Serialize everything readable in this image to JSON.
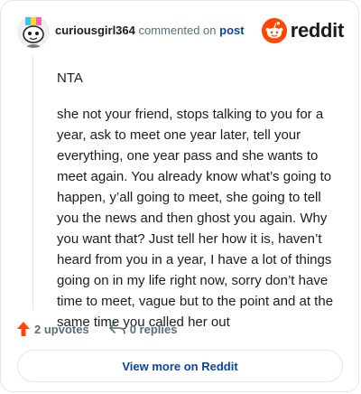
{
  "header": {
    "username": "curiousgirl364",
    "commented_text": "commented on",
    "post_link": "post",
    "brand": "reddit"
  },
  "comment": {
    "paragraphs": [
      "NTA",
      "she not your friend, stops talking to you for a year, ask to meet one year later, tell your everything, one year pass and she wants to meet again. You already know what’s going to happen, y’all going to meet, she going to tell you the news and then ghost you again. Why you want that? Just tell her how it is, haven’t heard from you in a year, I have a lot of things going on in my life right now, sorry don’t have time to meet, vague but to the point and at the same time you called her out"
    ]
  },
  "actions": {
    "upvotes": "2 upvotes",
    "replies": "0 replies"
  },
  "footer": {
    "view_more": "View more on Reddit"
  },
  "colors": {
    "brand_orange": "#ff4500",
    "link_blue": "#0a449b",
    "muted_text": "#576f76"
  },
  "icons": {
    "upvote": "arrow-up-icon",
    "reply": "reply-arrow-icon",
    "brand": "reddit-snoo-icon"
  }
}
